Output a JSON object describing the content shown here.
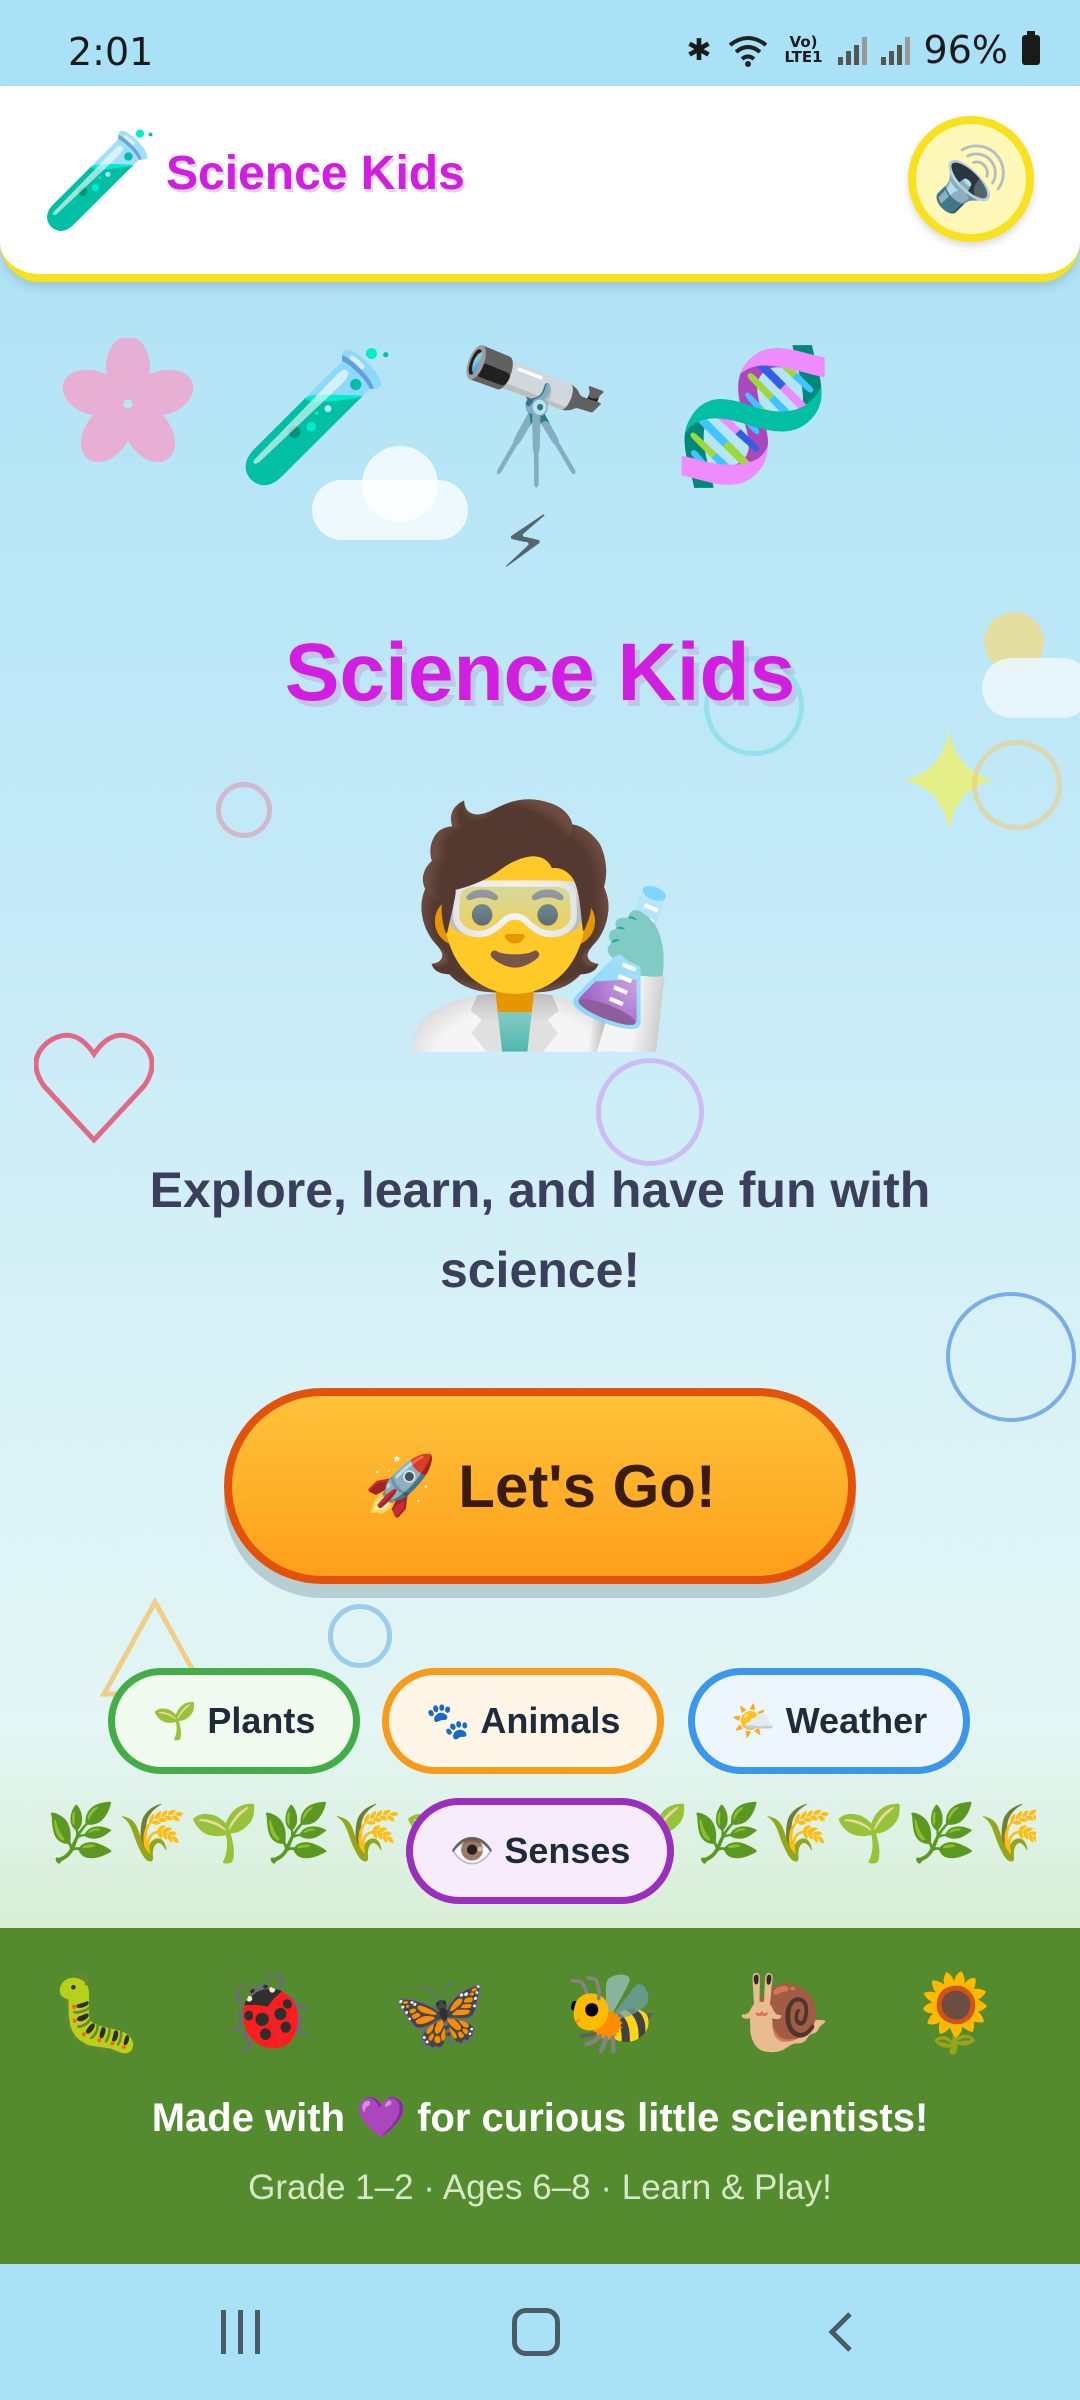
{
  "status_bar": {
    "time": "2:01",
    "battery": "96%",
    "lte_label": "Vo) LTE1",
    "icons": [
      "bluetooth-icon",
      "wifi-icon",
      "signal-icon",
      "battery-icon"
    ]
  },
  "header": {
    "logo_icon": "🧪",
    "title": "Science Kids",
    "sound_icon": "🔊"
  },
  "hero": {
    "icons": [
      "🧪",
      "🔭",
      "🧬"
    ],
    "title": "Science Kids",
    "mascot": "🧑‍🔬",
    "tagline": "Explore, learn, and have fun with science!",
    "cta_icon": "🚀",
    "cta_label": "Let's Go!"
  },
  "topics": [
    {
      "icon": "🌱",
      "label": "Plants",
      "color": "#43ad47"
    },
    {
      "icon": "🐾",
      "label": "Animals",
      "color": "#f79b1b"
    },
    {
      "icon": "🌤️",
      "label": "Weather",
      "color": "#3b97eb"
    },
    {
      "icon": "👁️",
      "label": "Senses",
      "color": "#9a2fbf"
    }
  ],
  "plants_row": "🌿🌾🌱🌿🌾🌱🌿🌾🌱🌿🌾🌱🌿🌾🌱🌿",
  "footer": {
    "critters": [
      "🐛",
      "🐞",
      "🦋",
      "🐝",
      "🐌",
      "🌻"
    ],
    "made_with": "Made with 💜 for curious little scientists!",
    "grade_info": "Grade 1–2 · Ages 6–8 · Learn & Play!"
  },
  "colors": {
    "accent_magenta": "#d21ee0",
    "header_border": "#f6e21c",
    "cta_orange": "#ff9f1a",
    "footer_green": "#558b2f"
  }
}
